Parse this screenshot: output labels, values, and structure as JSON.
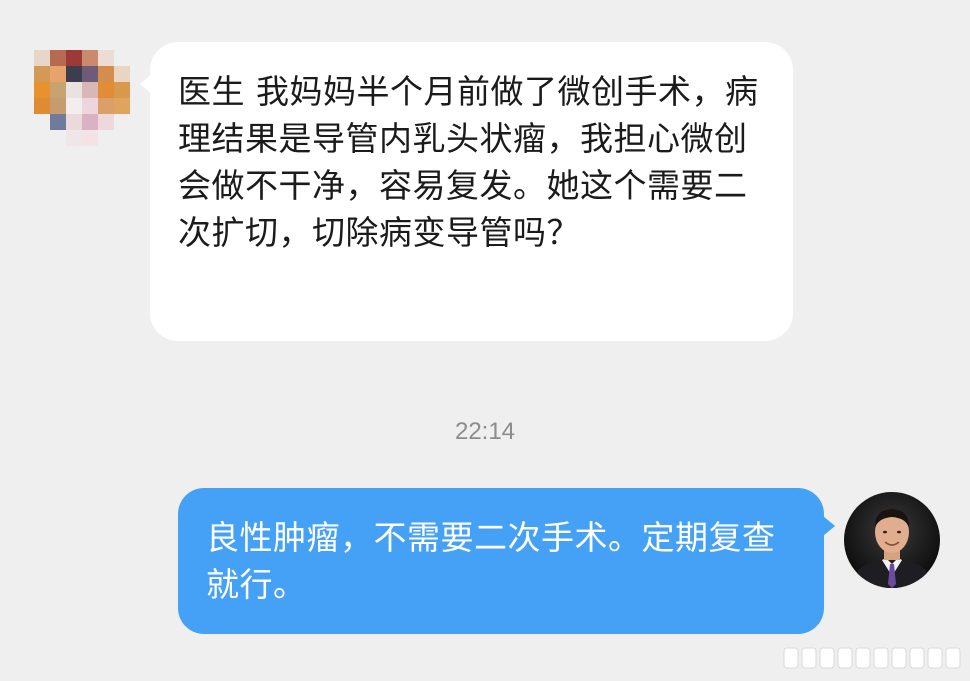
{
  "messages": [
    {
      "direction": "incoming",
      "text": "医生 我妈妈半个月前做了微创手术，病理结果是导管内乳头状瘤，我担心微创会做不干净，容易复发。她这个需要二次扩切，切除病变导管吗？"
    },
    {
      "direction": "outgoing",
      "text": "良性肿瘤，不需要二次手术。定期复查就行。"
    }
  ],
  "timestamp": "22:14",
  "colors": {
    "background": "#efefef",
    "incoming_bubble": "#ffffff",
    "outgoing_bubble": "#45a1f6"
  }
}
